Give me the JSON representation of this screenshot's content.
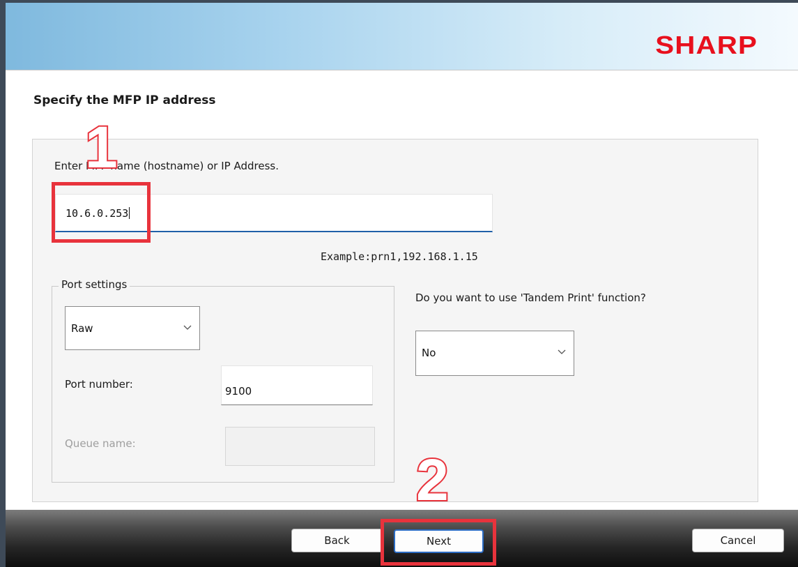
{
  "brand": {
    "logo_text": "SHARP",
    "logo_color": "#e8101d"
  },
  "page": {
    "title": "Specify the MFP IP address"
  },
  "host": {
    "label": "Enter MFP name (hostname) or IP Address.",
    "value": "10.6.0.253",
    "example": "Example:prn1,192.168.1.15"
  },
  "port_settings": {
    "legend": "Port settings",
    "protocol_selected": "Raw",
    "port_number_label": "Port number:",
    "port_number_value": "9100",
    "queue_name_label": "Queue name:",
    "queue_name_value": ""
  },
  "tandem": {
    "question": "Do you want to use 'Tandem Print' function?",
    "selected": "No"
  },
  "buttons": {
    "back": "Back",
    "next": "Next",
    "cancel": "Cancel"
  },
  "annotations": {
    "step1": "1",
    "step2": "2",
    "highlight_color": "#e8333c"
  }
}
